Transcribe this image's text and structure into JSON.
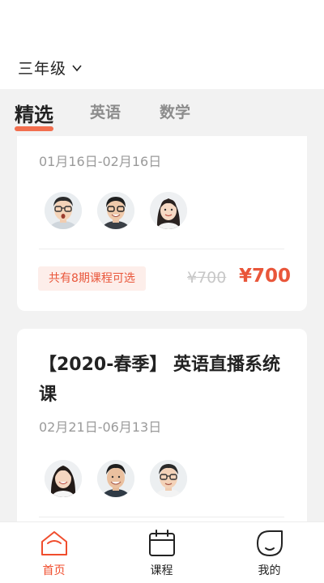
{
  "header": {
    "grade": "三年级"
  },
  "tabs": [
    {
      "label": "精选",
      "active": true
    },
    {
      "label": "英语",
      "active": false
    },
    {
      "label": "数学",
      "active": false
    }
  ],
  "cards": [
    {
      "date": "01月16日-02月16日",
      "teachers": [
        "teacher-1",
        "teacher-2",
        "teacher-3"
      ],
      "badge": "共有8期课程可选",
      "original_price": "¥700",
      "price": "¥700"
    },
    {
      "title": "【2020-春季】 英语直播系统课",
      "date": "02月21日-06月13日",
      "teachers": [
        "teacher-4",
        "teacher-5",
        "teacher-6"
      ]
    }
  ],
  "nav": [
    {
      "label": "首页",
      "icon": "home-icon",
      "active": true
    },
    {
      "label": "课程",
      "icon": "calendar-icon",
      "active": false
    },
    {
      "label": "我的",
      "icon": "profile-icon",
      "active": false
    }
  ],
  "colors": {
    "accent": "#f04d2d",
    "background": "#f2f2f2"
  }
}
